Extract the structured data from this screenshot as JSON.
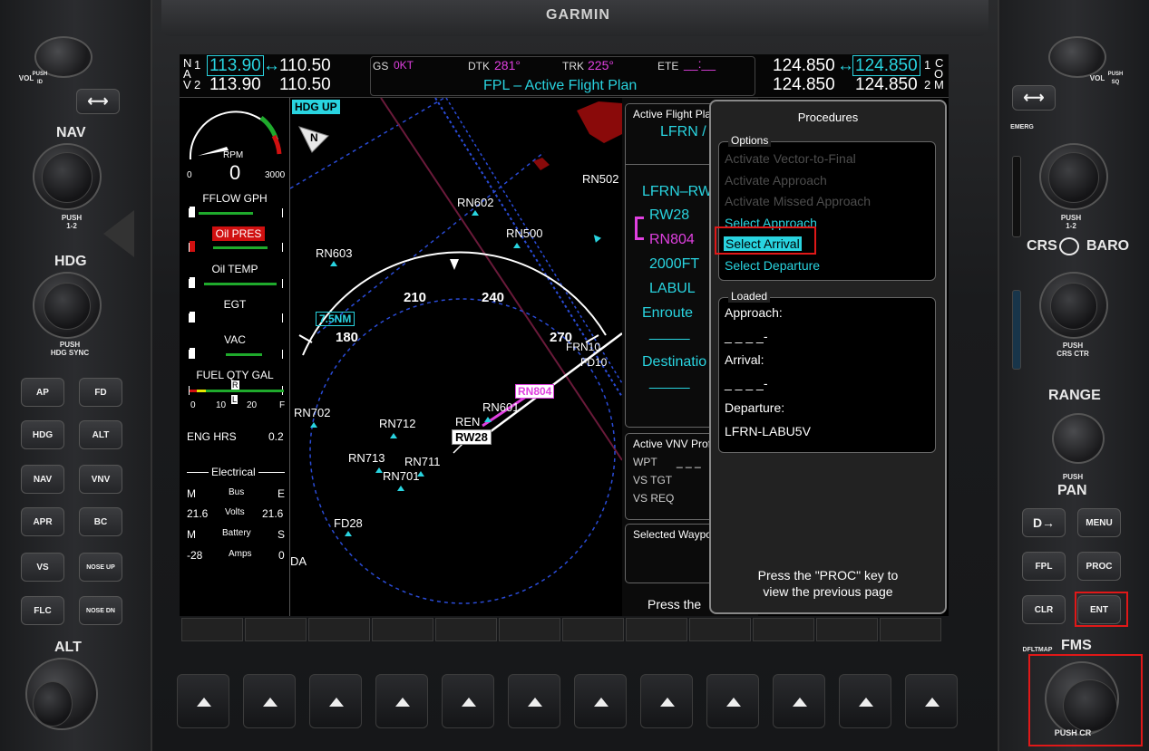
{
  "brand": "GARMIN",
  "left_panel": {
    "vol_label": "VOL",
    "vol_push": "PUSH\nID",
    "nav_label": "NAV",
    "nav_push": "PUSH\n1-2",
    "hdg_label": "HDG",
    "hdg_push": "PUSH\nHDG SYNC",
    "alt_label": "ALT",
    "buttons": [
      "AP",
      "FD",
      "HDG",
      "ALT",
      "NAV",
      "VNV",
      "APR",
      "BC",
      "VS",
      "NOSE UP",
      "FLC",
      "NOSE DN"
    ]
  },
  "right_panel": {
    "vol_label": "VOL",
    "vol_push": "PUSH\nSQ",
    "emerg": "EMERG",
    "com_push": "PUSH\n1-2",
    "crs_label": "CRS",
    "baro_label": "BARO",
    "crs_push": "PUSH\nCRS CTR",
    "range_label": "RANGE",
    "pan_push": "PUSH",
    "pan_label": "PAN",
    "buttons": [
      "D→",
      "MENU",
      "FPL",
      "PROC",
      "CLR",
      "ENT"
    ],
    "dfltmap": "DFLTMAP",
    "fms_label": "FMS",
    "fms_push": "PUSH CR"
  },
  "topbar": {
    "nav_letters": [
      "N",
      "A",
      "V"
    ],
    "nav1_active": "113.90",
    "nav1_standby": "110.50",
    "nav2_active": "113.90",
    "nav2_standby": "110.50",
    "nav1_num": "1",
    "nav2_num": "2",
    "gs_label": "GS",
    "gs_value": "0KT",
    "dtk_label": "DTK",
    "dtk_value": "281°",
    "trk_label": "TRK",
    "trk_value": "225°",
    "ete_label": "ETE",
    "ete_value": "__:__",
    "page_title": "FPL – Active Flight Plan",
    "com1_standby": "124.850",
    "com1_active": "124.850",
    "com2_standby": "124.850",
    "com2_active": "124.850",
    "com_letters": [
      "C",
      "O",
      "M"
    ],
    "com1_num": "1",
    "com2_num": "2"
  },
  "eis": {
    "rpm_label": "RPM",
    "rpm_value": "0",
    "rpm_min": "0",
    "rpm_max": "3000",
    "fflow_label": "FFLOW GPH",
    "oil_pres_label": "Oil PRES",
    "oil_temp_label": "Oil TEMP",
    "egt_label": "EGT",
    "vac_label": "VAC",
    "fuel_label": "FUEL QTY GAL",
    "fuel_ticks": [
      "0",
      "10",
      "20",
      "F"
    ],
    "fuel_marks": [
      "R",
      "L"
    ],
    "eng_hrs_label": "ENG HRS",
    "eng_hrs_value": "0.2",
    "electrical_label": "Electrical",
    "bus_label": "Bus",
    "bus_left": "M",
    "bus_right": "E",
    "volts_label": "Volts",
    "volts_left": "21.6",
    "volts_right": "21.6",
    "battery_label": "Battery",
    "battery_left": "M",
    "battery_right": "S",
    "amps_label": "Amps",
    "amps_left": "-28",
    "amps_right": "0"
  },
  "map": {
    "orientation": "HDG UP",
    "north_label": "N",
    "range": "7.5NM",
    "heading_labels": [
      "180",
      "210",
      "240",
      "270"
    ],
    "waypoints": [
      "RN602",
      "RN500",
      "RN502",
      "RN603",
      "FRN10",
      "FD10",
      "RN804",
      "RN601",
      "RN702",
      "RN712",
      "REN",
      "RW28",
      "RN713",
      "RN711",
      "RN701",
      "FD28",
      "DA"
    ]
  },
  "fpl": {
    "header": "Active Flight Pla",
    "route": "LFRN /",
    "items": [
      "LFRN–RW",
      "RW28",
      "RN804",
      "2000FT",
      "LABUL",
      "Enroute",
      "_____",
      "Destinatio",
      "_____"
    ],
    "vnv_header": "Active VNV Prof",
    "vnv_rows": [
      "WPT",
      "VS TGT",
      "VS REQ"
    ],
    "vnv_dash": "_ _ _",
    "selected_wpt_header": "Selected Waypo",
    "press_text": "Press the"
  },
  "procedures": {
    "title": "Procedures",
    "options_label": "Options",
    "options": [
      {
        "label": "Activate Vector-to-Final",
        "state": "disabled"
      },
      {
        "label": "Activate Approach",
        "state": "disabled"
      },
      {
        "label": "Activate Missed Approach",
        "state": "disabled"
      },
      {
        "label": "Select Approach",
        "state": "enabled"
      },
      {
        "label": "Select Arrival",
        "state": "selected"
      },
      {
        "label": "Select Departure",
        "state": "enabled"
      }
    ],
    "loaded_label": "Loaded",
    "approach_label": "Approach:",
    "approach_value": "_ _ _ _-",
    "arrival_label": "Arrival:",
    "arrival_value": "_ _ _ _-",
    "departure_label": "Departure:",
    "departure_value": "LFRN-LABU5V",
    "footer_line1": "Press the \"PROC\" key to",
    "footer_line2": "view the previous page"
  },
  "colors": {
    "cyan": "#29d4e0",
    "magenta": "#e040e0",
    "highlight": "#e01818"
  }
}
